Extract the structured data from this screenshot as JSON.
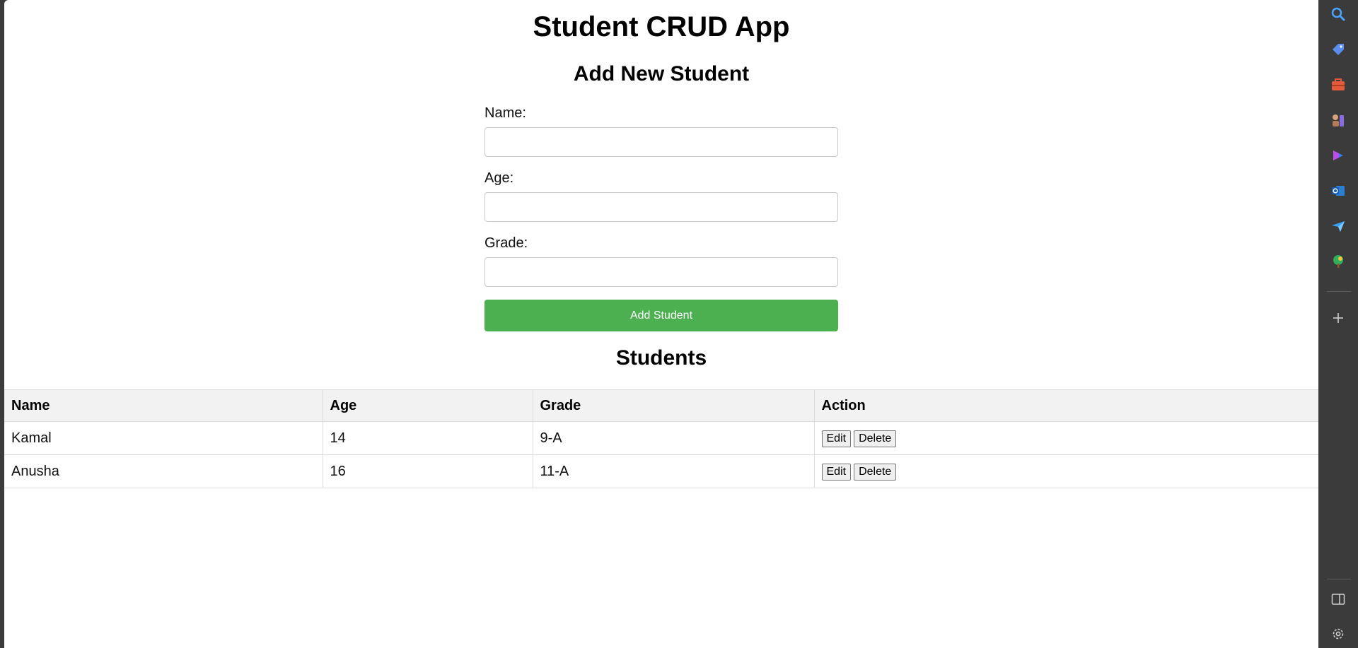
{
  "app": {
    "title": "Student CRUD App"
  },
  "form": {
    "title": "Add New Student",
    "name_label": "Name:",
    "name_value": "",
    "age_label": "Age:",
    "age_value": "",
    "grade_label": "Grade:",
    "grade_value": "",
    "submit_label": "Add Student",
    "submit_color": "#4caf50"
  },
  "students": {
    "title": "Students",
    "headers": [
      "Name",
      "Age",
      "Grade",
      "Action"
    ],
    "rows": [
      {
        "name": "Kamal",
        "age": "14",
        "grade": "9-A",
        "edit_label": "Edit",
        "delete_label": "Delete"
      },
      {
        "name": "Anusha",
        "age": "16",
        "grade": "11-A",
        "edit_label": "Edit",
        "delete_label": "Delete"
      }
    ]
  },
  "sidebar": {
    "icons": [
      "search-icon",
      "tag-icon",
      "briefcase-icon",
      "chess-icon",
      "copilot-icon",
      "outlook-icon",
      "send-icon",
      "tree-icon",
      "add-icon",
      "split-view-icon",
      "settings-icon"
    ]
  }
}
